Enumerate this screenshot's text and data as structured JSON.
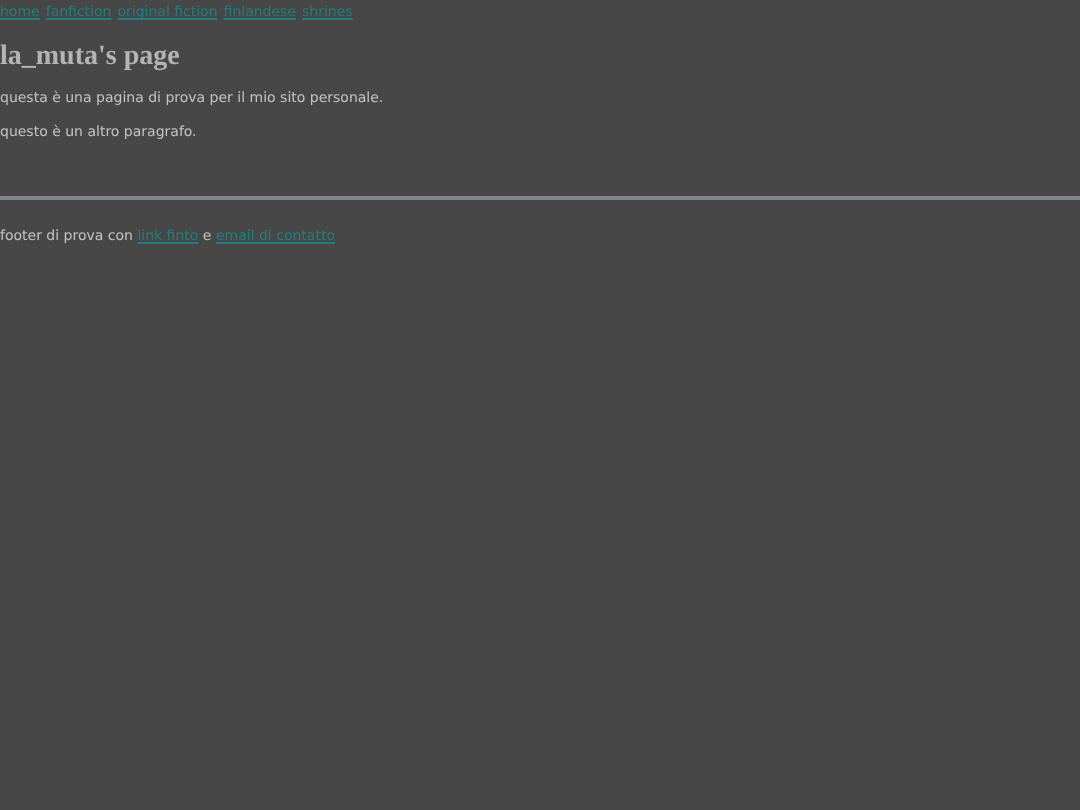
{
  "nav": [
    "home",
    "fanfiction",
    "original fiction",
    "finlandese",
    "shrines"
  ],
  "title": "la_muta's page",
  "paragraphs": [
    "questa è una pagina di prova per il mio sito personale.",
    "questo è un altro paragrafo."
  ],
  "footer": {
    "parts": [
      {
        "kind": "text",
        "text": "footer di prova con "
      },
      {
        "kind": "link",
        "text": "link finto"
      },
      {
        "kind": "text",
        "text": " e "
      },
      {
        "kind": "link",
        "text": "email di contatto"
      }
    ]
  }
}
